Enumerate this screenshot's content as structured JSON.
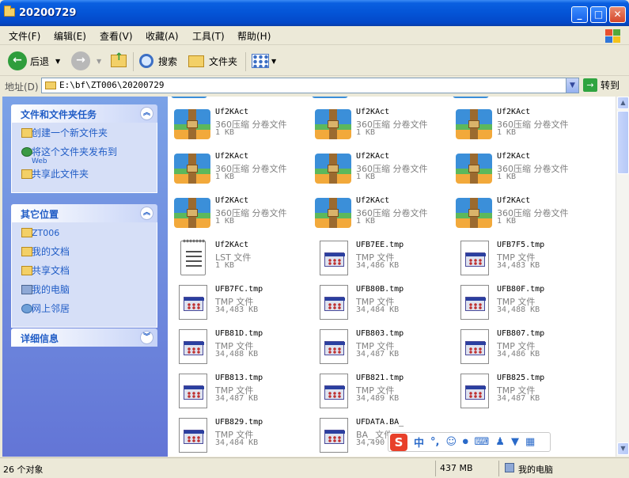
{
  "window": {
    "title": "20200729"
  },
  "menu": [
    "文件(F)",
    "编辑(E)",
    "查看(V)",
    "收藏(A)",
    "工具(T)",
    "帮助(H)"
  ],
  "toolbar": {
    "back": "后退",
    "search": "搜索",
    "folders": "文件夹"
  },
  "address": {
    "label": "地址(D)",
    "value": "E:\\bf\\ZT006\\20200729",
    "go": "转到"
  },
  "tasks": {
    "title": "文件和文件夹任务",
    "items": [
      {
        "label": "创建一个新文件夹",
        "sub": ""
      },
      {
        "label": "将这个文件夹发布到",
        "sub": "Web"
      },
      {
        "label": "共享此文件夹",
        "sub": ""
      }
    ]
  },
  "places": {
    "title": "其它位置",
    "items": [
      "ZT006",
      "我的文档",
      "共享文档",
      "我的电脑",
      "网上邻居"
    ]
  },
  "details": {
    "title": "详细信息"
  },
  "files": [
    {
      "name": "Uf2KAct",
      "type": "360压缩 分卷文件",
      "size": "1 KB",
      "kind": "zip"
    },
    {
      "name": "Uf2KAct",
      "type": "360压缩 分卷文件",
      "size": "1 KB",
      "kind": "zip"
    },
    {
      "name": "Uf2KAct",
      "type": "360压缩 分卷文件",
      "size": "1 KB",
      "kind": "zip"
    },
    {
      "name": "Uf2KAct",
      "type": "360压缩 分卷文件",
      "size": "1 KB",
      "kind": "zip"
    },
    {
      "name": "Uf2KAct",
      "type": "360压缩 分卷文件",
      "size": "1 KB",
      "kind": "zip"
    },
    {
      "name": "Uf2KAct",
      "type": "360压缩 分卷文件",
      "size": "1 KB",
      "kind": "zip"
    },
    {
      "name": "Uf2KAct",
      "type": "360压缩 分卷文件",
      "size": "1 KB",
      "kind": "zip"
    },
    {
      "name": "Uf2KAct",
      "type": "360压缩 分卷文件",
      "size": "1 KB",
      "kind": "zip"
    },
    {
      "name": "Uf2KAct",
      "type": "360压缩 分卷文件",
      "size": "1 KB",
      "kind": "zip"
    },
    {
      "name": "Uf2KAct",
      "type": "LST 文件",
      "size": "1 KB",
      "kind": "lst"
    },
    {
      "name": "UFB7EE.tmp",
      "type": "TMP 文件",
      "size": "34,486 KB",
      "kind": "tmp"
    },
    {
      "name": "UFB7F5.tmp",
      "type": "TMP 文件",
      "size": "34,483 KB",
      "kind": "tmp"
    },
    {
      "name": "UFB7FC.tmp",
      "type": "TMP 文件",
      "size": "34,483 KB",
      "kind": "tmp"
    },
    {
      "name": "UFB80B.tmp",
      "type": "TMP 文件",
      "size": "34,484 KB",
      "kind": "tmp"
    },
    {
      "name": "UFB80F.tmp",
      "type": "TMP 文件",
      "size": "34,488 KB",
      "kind": "tmp"
    },
    {
      "name": "UFB81D.tmp",
      "type": "TMP 文件",
      "size": "34,488 KB",
      "kind": "tmp"
    },
    {
      "name": "UFB803.tmp",
      "type": "TMP 文件",
      "size": "34,487 KB",
      "kind": "tmp"
    },
    {
      "name": "UFB807.tmp",
      "type": "TMP 文件",
      "size": "34,486 KB",
      "kind": "tmp"
    },
    {
      "name": "UFB813.tmp",
      "type": "TMP 文件",
      "size": "34,487 KB",
      "kind": "tmp"
    },
    {
      "name": "UFB821.tmp",
      "type": "TMP 文件",
      "size": "34,489 KB",
      "kind": "tmp"
    },
    {
      "name": "UFB825.tmp",
      "type": "TMP 文件",
      "size": "34,487 KB",
      "kind": "tmp"
    },
    {
      "name": "UFB829.tmp",
      "type": "TMP 文件",
      "size": "34,484 KB",
      "kind": "tmp"
    },
    {
      "name": "UFDATA.BA_",
      "type": "BA_ 文件",
      "size": "34,490 KB",
      "kind": "tmp"
    }
  ],
  "ime": {
    "logo": "S",
    "lang": "中",
    "punct": "°,"
  },
  "status": {
    "count": "26 个对象",
    "size": "437 MB",
    "location": "我的电脑"
  }
}
